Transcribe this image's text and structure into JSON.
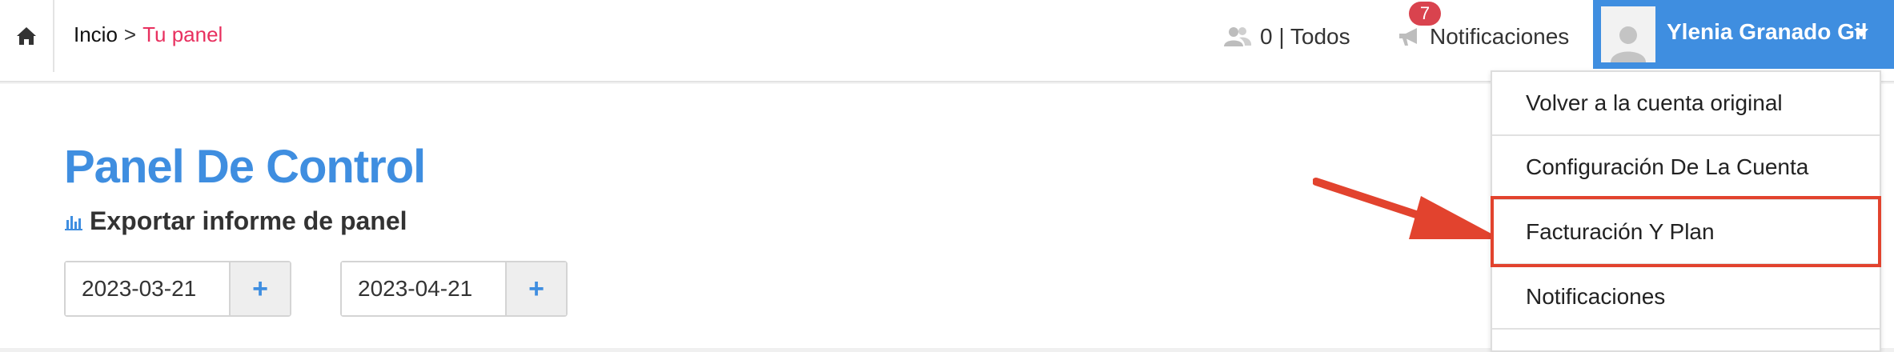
{
  "header": {
    "breadcrumb": {
      "home": "Incio",
      "separator": ">",
      "current": "Tu panel"
    },
    "users_stat": "0 | Todos",
    "notifications": {
      "label": "Notificaciones",
      "badge": "7"
    },
    "user": {
      "name": "Ylenia Granado Gil"
    }
  },
  "main": {
    "title": "Panel De Control",
    "export_label": "Exportar informe de panel",
    "date_from": "2023-03-21",
    "date_to": "2023-04-21",
    "plus_label": "+"
  },
  "dropdown": {
    "items": [
      {
        "label": "Volver a la cuenta original"
      },
      {
        "label": "Configuración De La Cuenta"
      },
      {
        "label": "Facturación Y Plan"
      },
      {
        "label": "Notificaciones"
      }
    ]
  },
  "colors": {
    "accent": "#3f8ee0",
    "breadcrumb_current": "#e8305f",
    "badge": "#d9434e",
    "highlight": "#e2432e"
  },
  "icons": {
    "home": "home-icon",
    "users": "users-icon",
    "megaphone": "megaphone-icon",
    "avatar": "avatar-placeholder-icon",
    "chart": "bar-chart-icon",
    "caret": "caret-down-icon"
  }
}
